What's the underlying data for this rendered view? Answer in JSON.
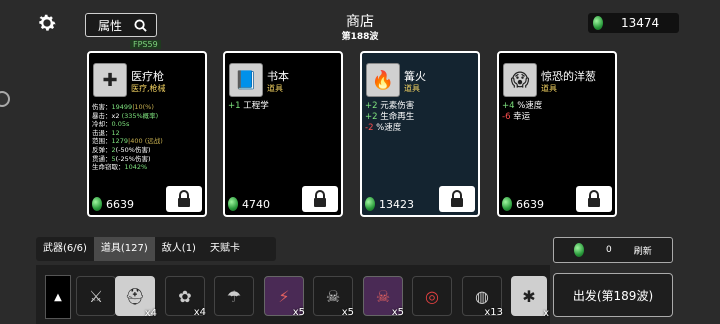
{
  "header": {
    "attr_label": "属性",
    "fps": "FPS59",
    "title": "商店",
    "wave": "第188波",
    "money": "13474"
  },
  "cards": [
    {
      "name": "医疗枪",
      "type": "医疗,枪械",
      "stats": [
        {
          "label": "伤害：",
          "value": "19499",
          "extra": "|10(%)"
        },
        {
          "label": "暴击：",
          "value": "x2",
          "extra": "(335%概率)"
        },
        {
          "label": "冷却：",
          "value": "0.05s",
          "extra": ""
        },
        {
          "label": "击退：",
          "value": "12",
          "extra": ""
        },
        {
          "label": "范围：",
          "value": "1279",
          "extra": "|400 (远战)"
        },
        {
          "label": "反弹：",
          "value": "2",
          "extra": "(-50%伤害)"
        },
        {
          "label": "贯通：",
          "value": "5",
          "extra": "(-25%伤害)"
        },
        {
          "label": "生命窃取：",
          "value": "1042%",
          "extra": ""
        }
      ],
      "price": "6639"
    },
    {
      "name": "书本",
      "type": "道具",
      "effects": [
        {
          "sign": "+1",
          "text": " 工程学",
          "color": "g"
        }
      ],
      "price": "4740"
    },
    {
      "name": "篝火",
      "type": "道具",
      "effects": [
        {
          "sign": "+2",
          "text": " 元素伤害",
          "color": "g"
        },
        {
          "sign": "+2",
          "text": " 生命再生",
          "color": "g"
        },
        {
          "sign": "-2",
          "text": " %速度",
          "color": "r"
        }
      ],
      "price": "13423"
    },
    {
      "name": "惊恐的洋葱",
      "type": "道具",
      "effects": [
        {
          "sign": "+4",
          "text": " %速度",
          "color": "g"
        },
        {
          "sign": "-6",
          "text": " 幸运",
          "color": "r"
        }
      ],
      "price": "6639"
    }
  ],
  "tabs": [
    "武器(6/6)",
    "道具(127)",
    "敌人(1)",
    "天赋卡"
  ],
  "reroll": {
    "cost": "0",
    "label": "刷新"
  },
  "inventory_counts": [
    "",
    "x4",
    "x4",
    "",
    "x5",
    "x5",
    "x5",
    "",
    "x13",
    "x"
  ],
  "depart_label": "出发(第189波)",
  "colors": {
    "accent_green": "#7ee27e",
    "negative_red": "#ff5050",
    "type_yellow": "#f0d060"
  }
}
